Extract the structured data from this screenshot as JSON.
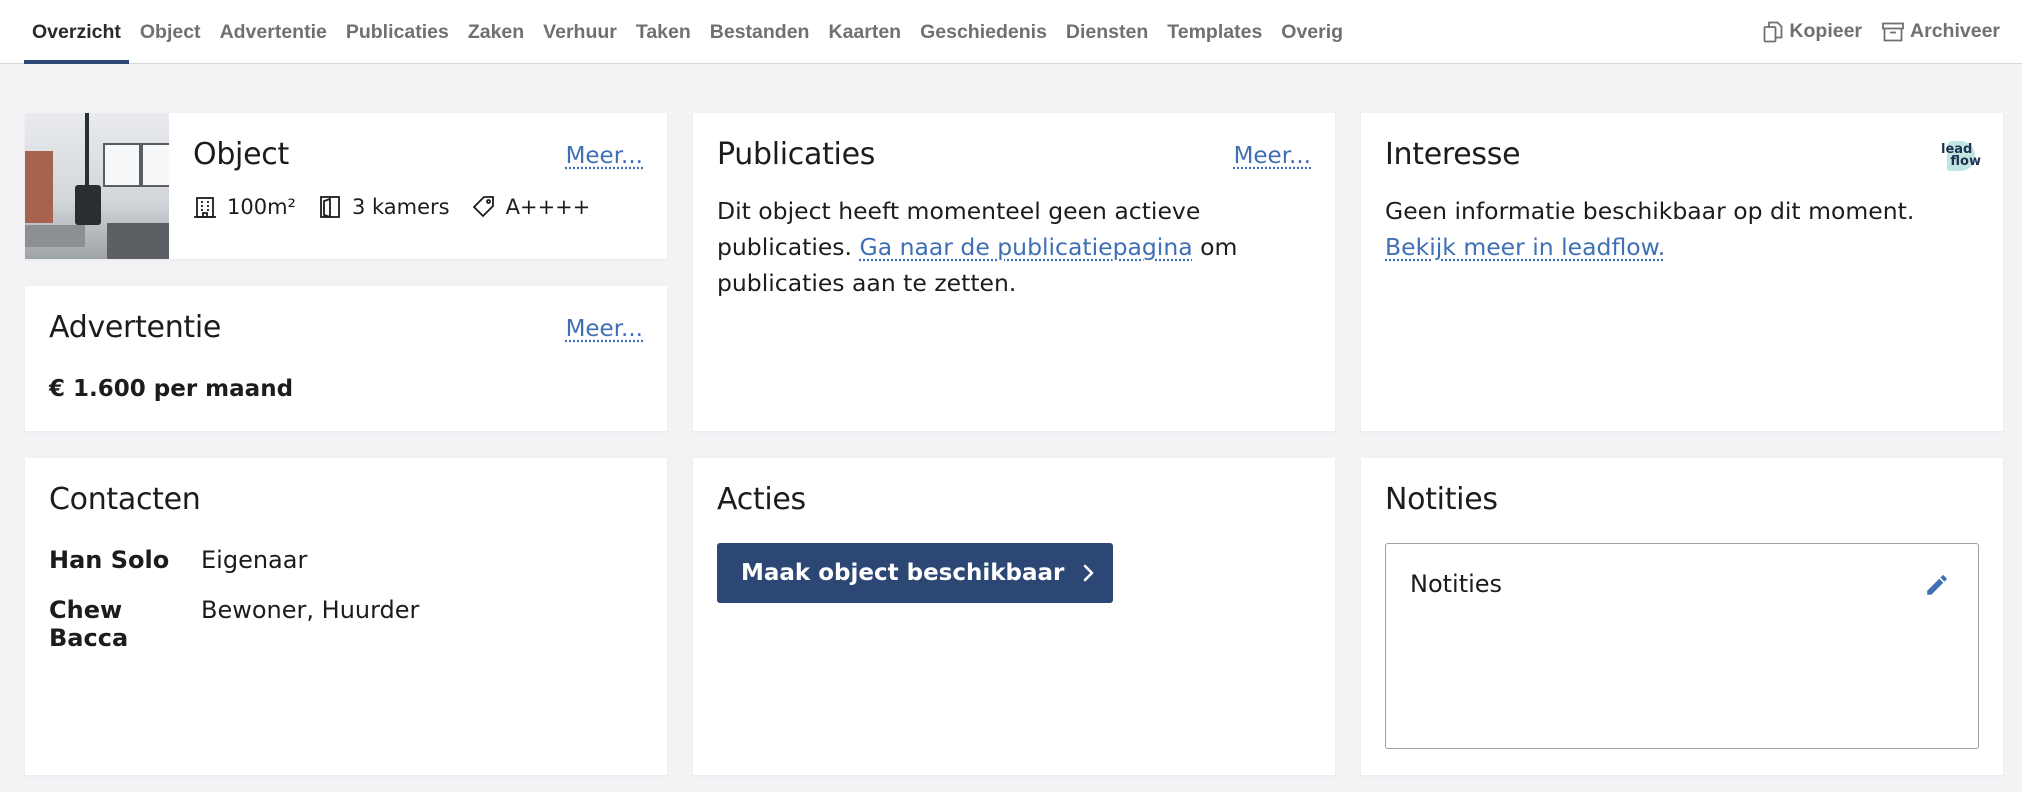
{
  "tabs": [
    {
      "label": "Overzicht",
      "active": true
    },
    {
      "label": "Object"
    },
    {
      "label": "Advertentie"
    },
    {
      "label": "Publicaties"
    },
    {
      "label": "Zaken"
    },
    {
      "label": "Verhuur"
    },
    {
      "label": "Taken"
    },
    {
      "label": "Bestanden"
    },
    {
      "label": "Kaarten"
    },
    {
      "label": "Geschiedenis"
    },
    {
      "label": "Diensten"
    },
    {
      "label": "Templates"
    },
    {
      "label": "Overig"
    }
  ],
  "top_actions": {
    "copy_label": "Kopieer",
    "copy_icon": "copy-icon",
    "archive_label": "Archiveer",
    "archive_icon": "archive-icon"
  },
  "object_card": {
    "title": "Object",
    "more_label": "Meer...",
    "area": "100m²",
    "rooms": "3 kamers",
    "energy_label": "A++++",
    "photo": "interior-photo"
  },
  "advert_card": {
    "title": "Advertentie",
    "more_label": "Meer...",
    "price": "€ 1.600 per maand"
  },
  "publications_card": {
    "title": "Publicaties",
    "more_label": "Meer...",
    "text": "Dit object heeft momenteel geen actieve publicaties.",
    "link_text": "Ga naar de publicatiepagina",
    "text_after": "om publicaties aan te zetten."
  },
  "interest_card": {
    "title": "Interesse",
    "text": "Geen informatie beschikbaar op dit moment.",
    "link_text": "Bekijk meer in leadflow.",
    "logo_line1": "lead",
    "logo_line2": "flow"
  },
  "contacts_card": {
    "title": "Contacten",
    "contacts": [
      {
        "name": "Han Solo",
        "role": "Eigenaar"
      },
      {
        "name": "Chew Bacca",
        "role": "Bewoner, Huurder"
      }
    ]
  },
  "actions_card": {
    "title": "Acties",
    "button_label": "Maak object beschikbaar"
  },
  "notes_card": {
    "title": "Notities",
    "field_text": "Notities"
  },
  "colors": {
    "accent": "#2c4773",
    "link": "#3f6fb4",
    "background": "#f3f3f6"
  }
}
